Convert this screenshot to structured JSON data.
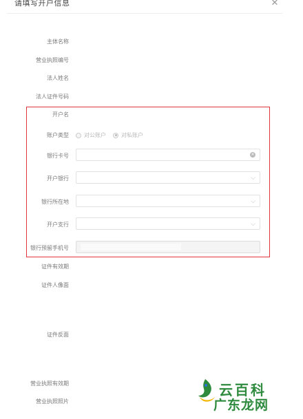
{
  "dialog": {
    "title": "请填写开户信息"
  },
  "fields": {
    "entity_name": "主体名称",
    "business_license_no": "营业执照编号",
    "legal_person_name": "法人姓名",
    "legal_person_id_no": "法人证件号码",
    "account_name": "开户名",
    "account_type": "账户类型",
    "bank_card_no": "银行卡号",
    "opening_bank": "开户银行",
    "bank_location": "银行所在地",
    "opening_branch": "开户支行",
    "bank_reserved_phone": "银行预留手机号",
    "id_validity": "证件有效期",
    "id_portrait_side": "证件人像面",
    "id_back_side": "证件反面",
    "license_validity": "营业执照有效期",
    "license_photo": "营业执照照片"
  },
  "account_type_options": [
    {
      "label": "对公账户",
      "checked": false
    },
    {
      "label": "对私账户",
      "checked": true
    }
  ],
  "watermark": {
    "line1": "云百科",
    "line2": "广东龙网"
  },
  "colors": {
    "highlight": "#e0343a",
    "brand": "#2e8b3e"
  }
}
